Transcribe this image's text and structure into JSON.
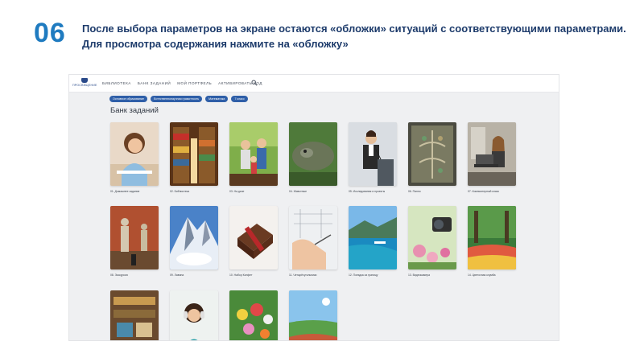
{
  "slide": {
    "number": "06",
    "caption_line1": "После выбора параметров на экране остаются «обложки» ситуаций с соответствующими параметрами.",
    "caption_line2": "Для просмотра содержания нажмите на «обложку»"
  },
  "app": {
    "logo_text": "ПРОСВЕЩЕНИЕ",
    "nav": [
      "БИБЛИОТЕКА",
      "БАНК ЗАДАНИЙ",
      "МОЙ ПОРТФЕЛЬ",
      "АКТИВИРОВАТЬ КОД"
    ],
    "chips": [
      "Основное образование",
      "Естественнонаучная грамотность",
      "Математика",
      "7 класс"
    ],
    "page_title": "Банк заданий",
    "cards": [
      {
        "label": "01. Домашнее задание",
        "icon": "girl-at-desk-photo"
      },
      {
        "label": "02. Библиотека",
        "icon": "library-shelves-photo"
      },
      {
        "label": "03. На даче",
        "icon": "family-garden-photo"
      },
      {
        "label": "04. Животные",
        "icon": "lizard-photo"
      },
      {
        "label": "05. Исследования и проекты",
        "icon": "speaker-podium-photo"
      },
      {
        "label": "06. Панно",
        "icon": "mosaic-panel-photo"
      },
      {
        "label": "07. Компьютерный класс",
        "icon": "woman-laptop-cafe-photo"
      },
      {
        "label": "08. Экскурсия",
        "icon": "museum-statues-photo"
      },
      {
        "label": "09. Лавина",
        "icon": "avalanche-mountain-photo"
      },
      {
        "label": "10. Набор Конфет",
        "icon": "chocolate-box-photo"
      },
      {
        "label": "11. Четырёхугольники",
        "icon": "hand-drawing-plan-photo"
      },
      {
        "label": "12. Поездка за границу",
        "icon": "sea-coast-photo"
      },
      {
        "label": "13. Видеокамера",
        "icon": "camera-flowers-photo"
      },
      {
        "label": "14. Цветочная клумба",
        "icon": "flower-park-alley-photo"
      },
      {
        "label": "",
        "icon": "shop-interior-photo"
      },
      {
        "label": "",
        "icon": "girl-headphones-photo"
      },
      {
        "label": "",
        "icon": "flowers-bouquet-photo"
      },
      {
        "label": "",
        "icon": "running-track-photo"
      }
    ]
  }
}
